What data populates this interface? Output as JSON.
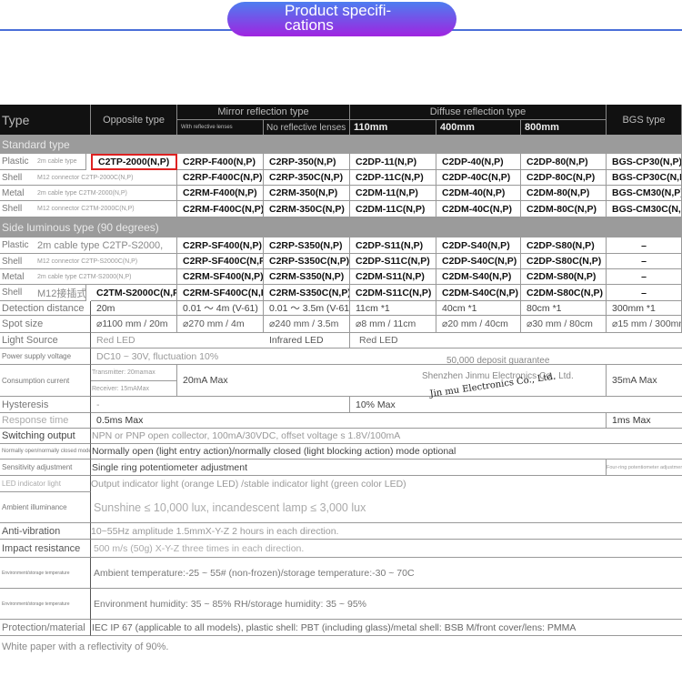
{
  "banner": {
    "title": "Product specifi-\ncations",
    "accent_top": "#4d7df0",
    "accent_bottom": "#a024e0"
  },
  "header": {
    "type": "Type",
    "opposite": "Opposite type",
    "mirror": "Mirror reflection type",
    "mirror_with": "With reflective lenses",
    "mirror_without": "No reflective lenses",
    "diffuse": "Diffuse reflection type",
    "d110": "110mm",
    "d400": "400mm",
    "d800": "800mm",
    "bgs": "BGS type"
  },
  "bands": {
    "standard": "Standard type",
    "side": "Side luminous type (90 degrees)"
  },
  "standard_rows": [
    {
      "label": "Plastic",
      "sub": "2m cable type",
      "opp": "C2TP-2000(N,P)",
      "cells": [
        "C2RP-F400(N,P)",
        "C2RP-350(N,P)",
        "C2DP-11(N,P)",
        "C2DP-40(N,P)",
        "C2DP-80(N,P)",
        "BGS-CP30(N,P)"
      ]
    },
    {
      "label": "Shell",
      "sub": "M12 connector C2TP-2000C(N,P)",
      "opp": "",
      "cells": [
        "C2RP-F400C(N,P)",
        "C2RP-350C(N,P)",
        "C2DP-11C(N,P)",
        "C2DP-40C(N,P)",
        "C2DP-80C(N,P)",
        "BGS-CP30C(N,P)"
      ]
    },
    {
      "label": "Metal",
      "sub": "2m cable type C2TM-2000(N,P)",
      "opp": "",
      "cells": [
        "C2RM-F400(N,P)",
        "C2RM-350(N,P)",
        "C2DM-11(N,P)",
        "C2DM-40(N,P)",
        "C2DM-80(N,P)",
        "BGS-CM30(N,P)"
      ]
    },
    {
      "label": "Shell",
      "sub": "M12 connector C2TM-2000C(N,P)",
      "opp": "",
      "cells": [
        "C2RM-F400C(N,P)",
        "C2RM-350C(N,P)",
        "C2DM-11C(N,P)",
        "C2DM-40C(N,P)",
        "C2DM-80C(N,P)",
        "BGS-CM30C(N,P)"
      ]
    }
  ],
  "side_rows": [
    {
      "label": "Plastic",
      "sub": "2m cable type C2TP-S2000,",
      "opp": "",
      "cells": [
        "C2RP-SF400(N,P)",
        "C2RP-S350(N,P)",
        "C2DP-S11(N,P)",
        "C2DP-S40(N,P)",
        "C2DP-S80(N,P)",
        "–"
      ]
    },
    {
      "label": "Shell",
      "sub": "M12 connector C2TP-S2000C(N,P)",
      "opp": "",
      "cells": [
        "C2RP-SF400C(N,P)",
        "C2RP-S350C(N,P)",
        "C2DP-S11C(N,P)",
        "C2DP-S40C(N,P)",
        "C2DP-S80C(N,P)",
        "–"
      ]
    },
    {
      "label": "Metal",
      "sub": "2m cable type C2TM-S2000(N,P)",
      "opp": "",
      "cells": [
        "C2RM-SF400(N,P)",
        "C2RM-S350(N,P)",
        "C2DM-S11(N,P)",
        "C2DM-S40(N,P)",
        "C2DM-S80(N,P)",
        "–"
      ]
    },
    {
      "label": "Shell",
      "sub": "M12接插式",
      "opp": "C2TM-S2000C(N,P)",
      "cells": [
        "C2RM-SF400C(N,P)",
        "C2RM-S350C(N,P)",
        "C2DM-S11C(N,P)",
        "C2DM-S40C(N,P)",
        "C2DM-S80C(N,P)",
        "–"
      ]
    }
  ],
  "specs": {
    "detection": {
      "label": "Detection distance",
      "values": [
        "20m",
        "0.01 ～ 4m (V-61)",
        "0.01 ～ 3.5m (V-61)",
        "11cm *1",
        "40cm *1",
        "80cm *1",
        "300mm *1"
      ]
    },
    "spot": {
      "label": "Spot size",
      "values": [
        "⌀1100 mm / 20m",
        "⌀270 mm / 4m",
        "⌀240 mm / 3.5m",
        "⌀8 mm / 11cm",
        "⌀20 mm / 40cm",
        "⌀30 mm / 80cm",
        "⌀15 mm / 300mm"
      ]
    },
    "light": {
      "label": "Light Source",
      "red": "Red LED",
      "ir": "Infrared LED",
      "red2": "Red LED"
    },
    "power": {
      "label": "Power supply voltage",
      "value": "DC10 ~ 30V, fluctuation 10%"
    },
    "current": {
      "label": "Consumption current",
      "tx": "Transmitter: 20mamax",
      "rx": "Receiver: 15mAMax",
      "main": "20mA Max",
      "bgs": "35mA Max"
    },
    "hysteresis": {
      "label": "Hysteresis",
      "value": "-",
      "diffuse": "10% Max"
    },
    "response": {
      "label": "Response time",
      "value": "0.5ms Max",
      "bgs": "1ms Max"
    },
    "switching": {
      "label": "Switching output",
      "value": "NPN or PNP open collector, 100mA/30VDC, offset voltage s 1.8V/100mA"
    },
    "mode": {
      "label": "Normally open/normally closed mode",
      "value": "Normally open (light entry action)/normally closed (light blocking action) mode optional"
    },
    "sensitivity": {
      "label": "Sensitivity adjustment",
      "value": "Single ring potentiometer adjustment",
      "bgs": "Four-ring potentiometer adjustment"
    },
    "led": {
      "label": "LED indicator light",
      "value": "Output indicator light (orange LED) /stable indicator light (green color LED)"
    },
    "ambient": {
      "label": "Ambient illuminance",
      "value": "Sunshine ≤ 10,000 lux, incandescent lamp ≤ 3,000 lux"
    },
    "vibration": {
      "label": "Anti-vibration",
      "value": "10~55Hz amplitude 1.5mmX-Y-Z 2 hours in each direction."
    },
    "impact": {
      "label": "Impact resistance",
      "value": "500 m/s (50g) X-Y-Z three times in each direction."
    },
    "temp": {
      "label": "Environment/storage temperature",
      "value": "Ambient temperature:-25 ~ 55# (non-frozen)/storage temperature:-30 ~ 70C"
    },
    "humidity": {
      "label": "Environment/storage temperature",
      "value": "Environment humidity: 35 ~ 85% RH/storage humidity: 35 ~ 95%"
    },
    "protection": {
      "label": "Protection/material",
      "value": "IEC IP 67 (applicable to all models), plastic shell: PBT (including glass)/metal shell: BSB M/front cover/lens: PMMA"
    }
  },
  "watermark": {
    "line1": "50,000 deposit guarantee",
    "line2": "Shenzhen Jinmu Electronics Co., Ltd.",
    "line3": "Jin mu Electronics Co., Ltd."
  },
  "footnote": "White paper with a reflectivity of 90%."
}
